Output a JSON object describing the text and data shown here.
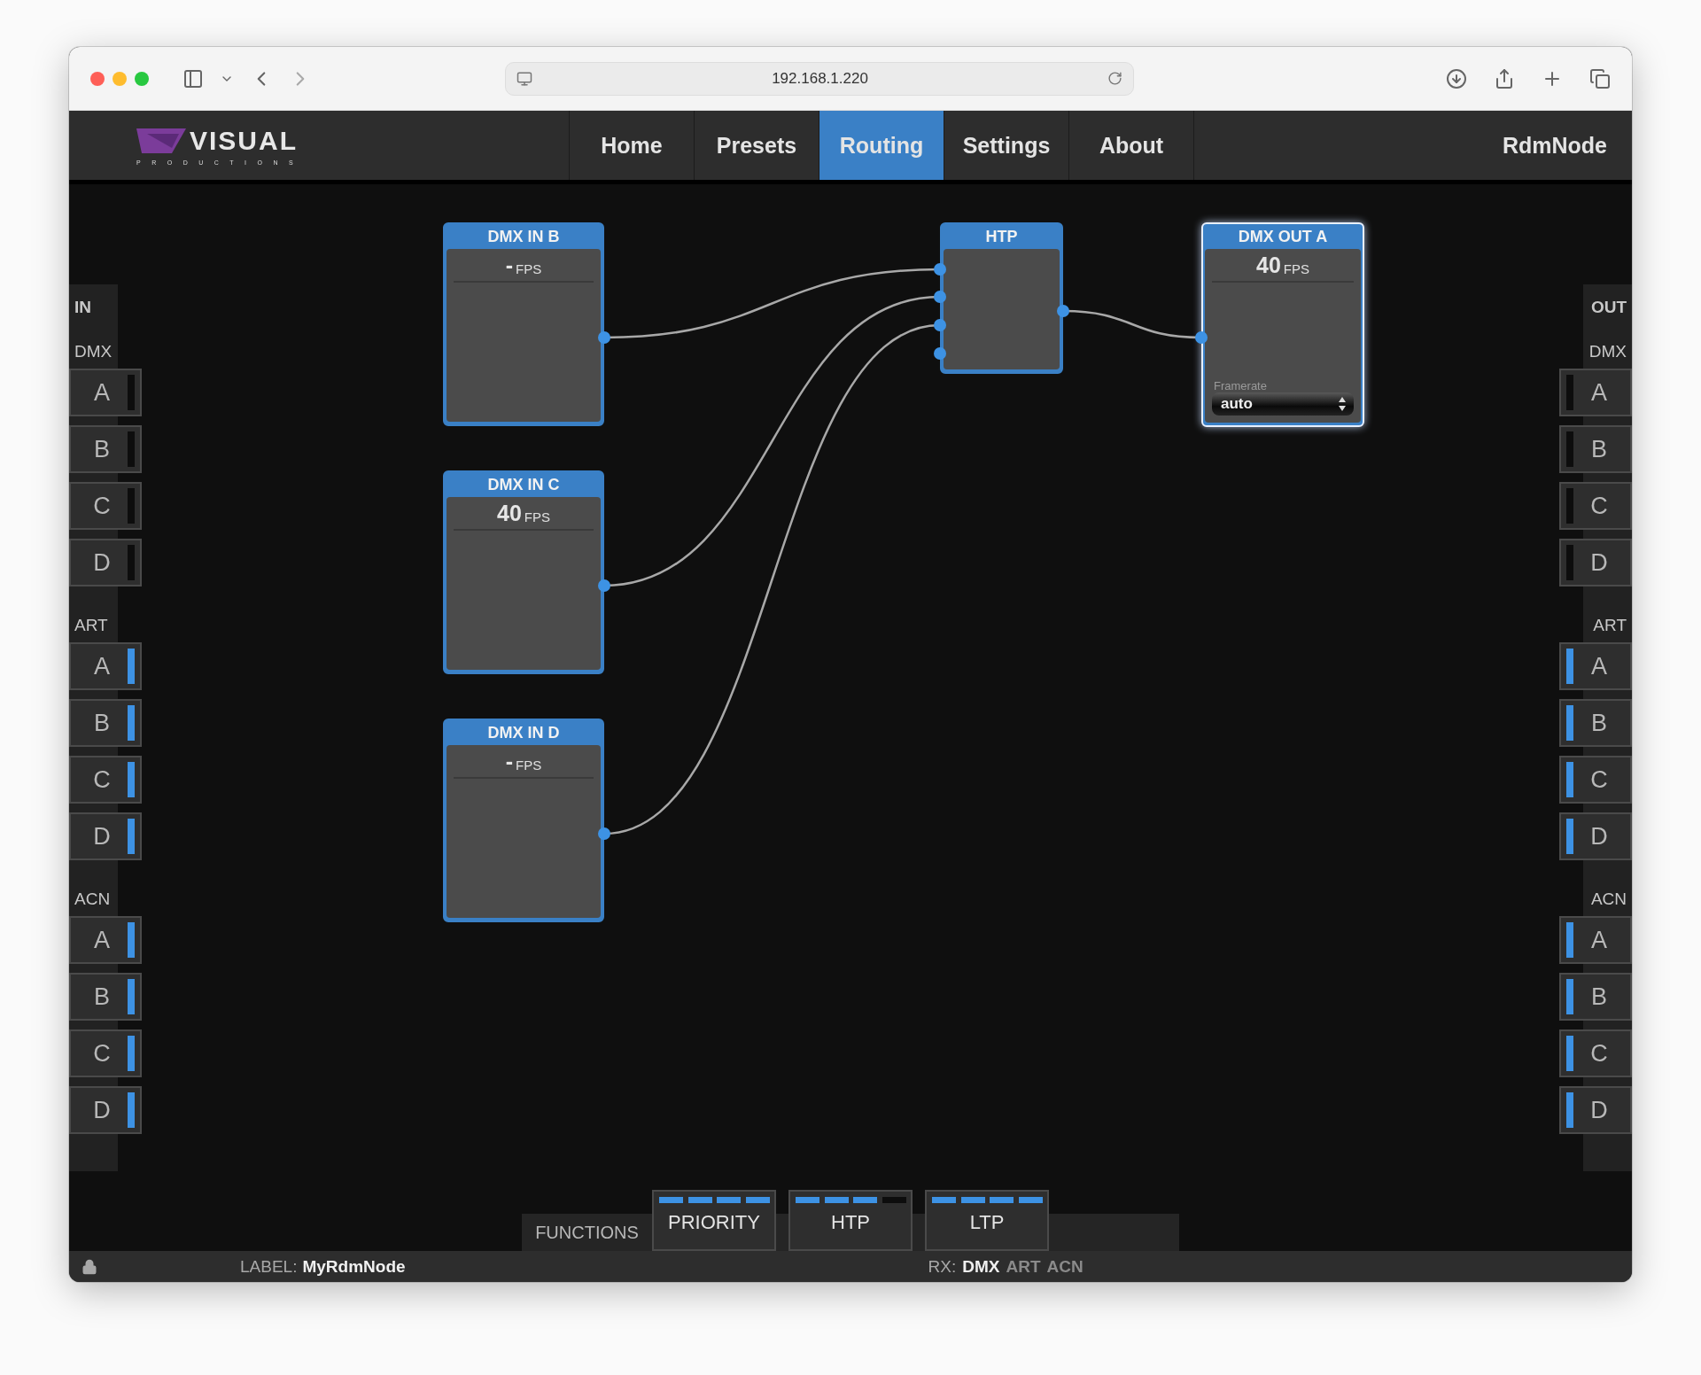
{
  "browser": {
    "url": "192.168.1.220"
  },
  "logo": {
    "name": "VISUAL",
    "tagline": "PRODUCTIONS"
  },
  "nav": {
    "tabs": [
      {
        "label": "Home",
        "selected": false
      },
      {
        "label": "Presets",
        "selected": false
      },
      {
        "label": "Routing",
        "selected": true
      },
      {
        "label": "Settings",
        "selected": false
      },
      {
        "label": "About",
        "selected": false
      }
    ],
    "device": "RdmNode"
  },
  "inputs": {
    "title": "IN",
    "groups": [
      {
        "label": "DMX",
        "ports": [
          {
            "label": "A",
            "active": false
          },
          {
            "label": "B",
            "active": false
          },
          {
            "label": "C",
            "active": false
          },
          {
            "label": "D",
            "active": false
          }
        ]
      },
      {
        "label": "ART",
        "ports": [
          {
            "label": "A",
            "active": true
          },
          {
            "label": "B",
            "active": true
          },
          {
            "label": "C",
            "active": true
          },
          {
            "label": "D",
            "active": true
          }
        ]
      },
      {
        "label": "ACN",
        "ports": [
          {
            "label": "A",
            "active": true
          },
          {
            "label": "B",
            "active": true
          },
          {
            "label": "C",
            "active": true
          },
          {
            "label": "D",
            "active": true
          }
        ]
      }
    ]
  },
  "outputs": {
    "title": "OUT",
    "groups": [
      {
        "label": "DMX",
        "ports": [
          {
            "label": "A",
            "active": false
          },
          {
            "label": "B",
            "active": false
          },
          {
            "label": "C",
            "active": false
          },
          {
            "label": "D",
            "active": false
          }
        ]
      },
      {
        "label": "ART",
        "ports": [
          {
            "label": "A",
            "active": true
          },
          {
            "label": "B",
            "active": true
          },
          {
            "label": "C",
            "active": true
          },
          {
            "label": "D",
            "active": true
          }
        ]
      },
      {
        "label": "ACN",
        "ports": [
          {
            "label": "A",
            "active": true
          },
          {
            "label": "B",
            "active": true
          },
          {
            "label": "C",
            "active": true
          },
          {
            "label": "D",
            "active": true
          }
        ]
      }
    ]
  },
  "nodes": [
    {
      "kind": "input",
      "title": "DMX IN B",
      "fps": "-",
      "fps_unit": "FPS",
      "selected": false
    },
    {
      "kind": "input",
      "title": "DMX IN C",
      "fps": "40",
      "fps_unit": "FPS",
      "selected": false
    },
    {
      "kind": "input",
      "title": "DMX IN D",
      "fps": "-",
      "fps_unit": "FPS",
      "selected": false
    },
    {
      "kind": "merge",
      "title": "HTP",
      "selected": false
    },
    {
      "kind": "output",
      "title": "DMX OUT A",
      "fps": "40",
      "fps_unit": "FPS",
      "selected": true,
      "field_label": "Framerate",
      "field_value": "auto"
    }
  ],
  "functions": {
    "label": "FUNCTIONS",
    "buttons": [
      {
        "label": "PRIORITY",
        "level": 1
      },
      {
        "label": "HTP",
        "level": 0.75
      },
      {
        "label": "LTP",
        "level": 1
      }
    ]
  },
  "status": {
    "label_key": "LABEL:",
    "label_value": "MyRdmNode",
    "rx_key": "RX:",
    "rx": [
      {
        "label": "DMX",
        "active": true
      },
      {
        "label": "ART",
        "active": false
      },
      {
        "label": "ACN",
        "active": false
      }
    ]
  }
}
